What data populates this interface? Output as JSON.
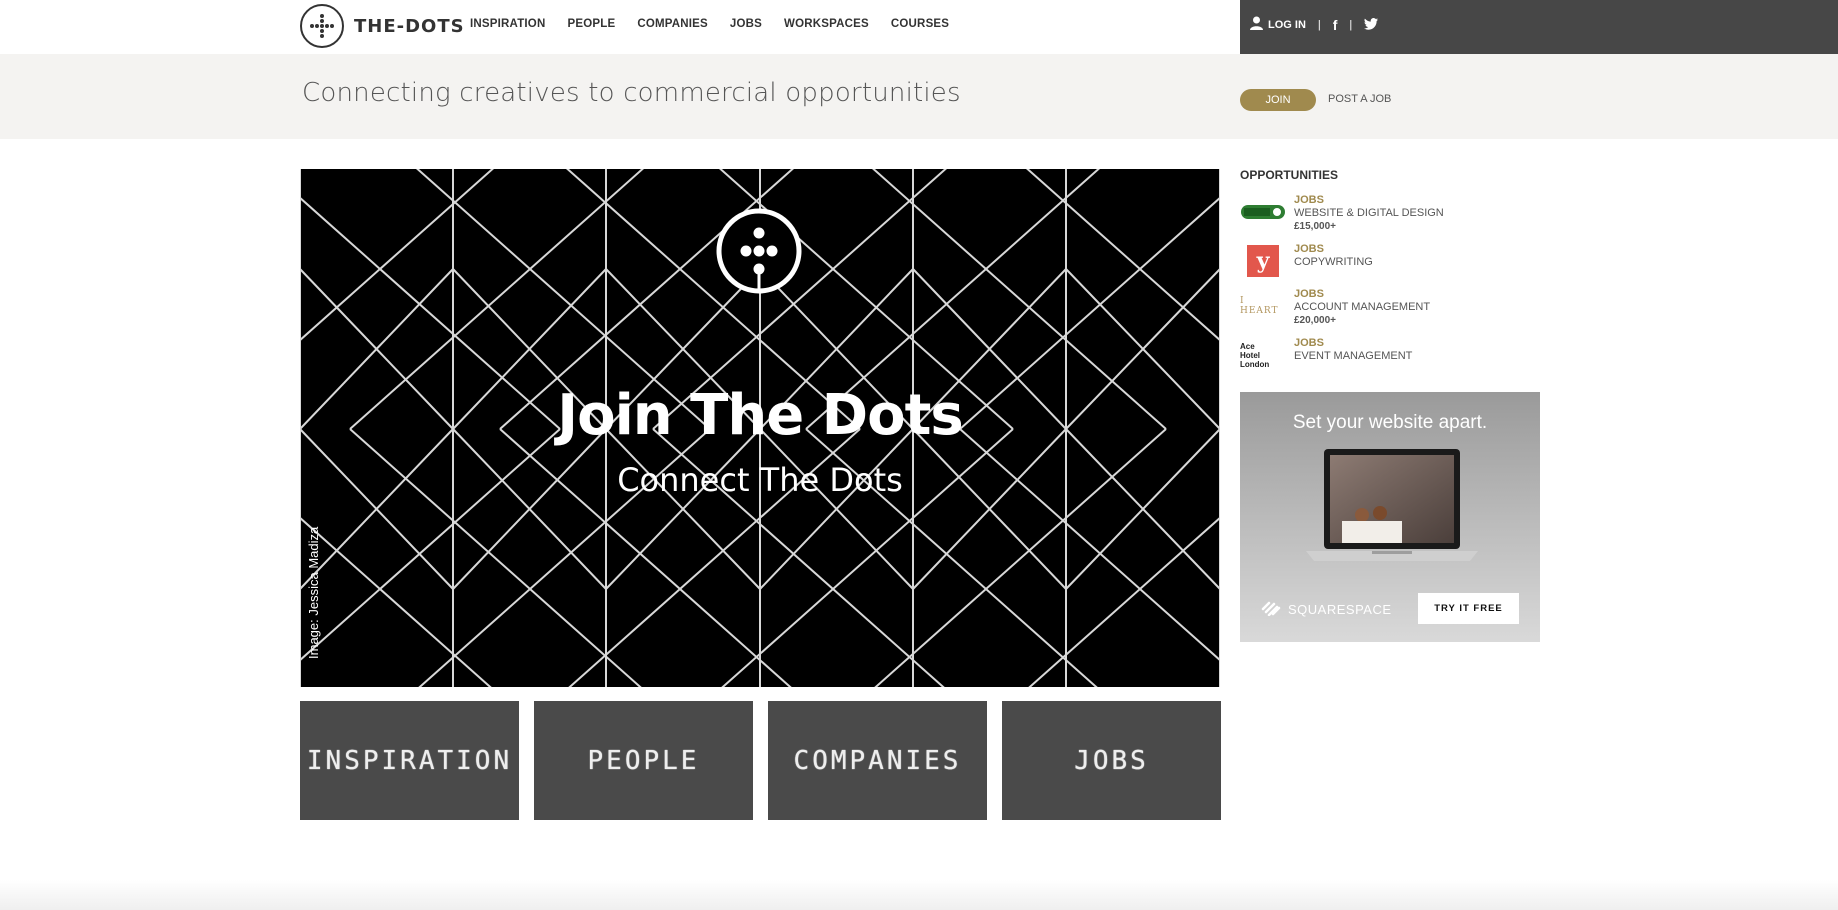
{
  "brand": {
    "name": "THE-DOTS"
  },
  "nav": {
    "items": [
      "INSPIRATION",
      "PEOPLE",
      "COMPANIES",
      "JOBS",
      "WORKSPACES",
      "COURSES"
    ],
    "login_label": "LOG IN",
    "social_icons": [
      "facebook-icon",
      "twitter-icon"
    ]
  },
  "subheader": {
    "tagline": "Connecting creatives to commercial opportunities",
    "join_label": "JOIN",
    "post_job_label": "POST A JOB"
  },
  "hero": {
    "title": "Join The Dots",
    "subtitle": "Connect The Dots",
    "credit": "Image: Jessica Madiza"
  },
  "tiles": [
    "INSPIRATION",
    "PEOPLE",
    "COMPANIES",
    "JOBS"
  ],
  "sidebar": {
    "title": "OPPORTUNITIES",
    "items": [
      {
        "logo": "",
        "category": "JOBS",
        "role": "WEBSITE & DIGITAL DESIGN",
        "salary": "£15,000+"
      },
      {
        "logo": "y",
        "category": "JOBS",
        "role": "COPYWRITING",
        "salary": ""
      },
      {
        "logo": "I HEART",
        "category": "JOBS",
        "role": "ACCOUNT MANAGEMENT",
        "salary": "£20,000+"
      },
      {
        "logo": "Ace Hotel London",
        "category": "JOBS",
        "role": "EVENT MANAGEMENT",
        "salary": ""
      }
    ]
  },
  "ad": {
    "headline": "Set your website apart.",
    "brand": "SQUARESPACE",
    "cta": "TRY IT FREE"
  },
  "colors": {
    "accent": "#a08a4e",
    "dark_bar": "#474747",
    "tile_bg": "#4a4a4a"
  }
}
